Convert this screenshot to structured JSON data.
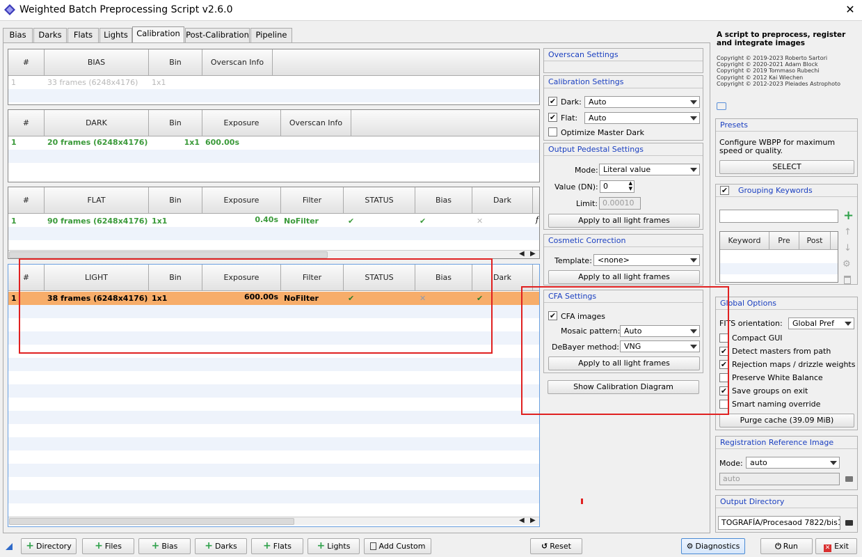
{
  "window": {
    "title": "Weighted Batch Preprocessing Script v2.6.0"
  },
  "tabs": [
    "Bias",
    "Darks",
    "Flats",
    "Lights",
    "Calibration",
    "Post-Calibration",
    "Pipeline"
  ],
  "bias_table": {
    "headers": [
      "#",
      "BIAS",
      "Bin",
      "Overscan Info"
    ],
    "row": [
      "1",
      "33 frames (6248x4176)",
      "1x1",
      ""
    ]
  },
  "dark_table": {
    "headers": [
      "#",
      "DARK",
      "Bin",
      "Exposure",
      "Overscan Info"
    ],
    "row": [
      "1",
      "20 frames (6248x4176)",
      "1x1",
      "600.00s",
      ""
    ]
  },
  "flat_table": {
    "headers": [
      "#",
      "FLAT",
      "Bin",
      "Exposure",
      "Filter",
      "STATUS",
      "Bias",
      "Dark"
    ],
    "row": [
      "1",
      "90 frames (6248x4176)",
      "1x1",
      "0.40s",
      "NoFilter",
      "✔",
      "✔",
      "✕"
    ],
    "extra": "f"
  },
  "light_table": {
    "headers": [
      "#",
      "LIGHT",
      "Bin",
      "Exposure",
      "Filter",
      "STATUS",
      "Bias",
      "Dark"
    ],
    "row": [
      "1",
      "38 frames (6248x4176)",
      "1x1",
      "600.00s",
      "NoFilter",
      "✔",
      "✕",
      "✔"
    ]
  },
  "overscan": {
    "title": "Overscan Settings"
  },
  "calibration": {
    "title": "Calibration Settings",
    "dark_label": "Dark:",
    "dark_value": "Auto",
    "flat_label": "Flat:",
    "flat_value": "Auto",
    "optimize_label": "Optimize Master Dark"
  },
  "pedestal": {
    "title": "Output Pedestal Settings",
    "mode_label": "Mode:",
    "mode_value": "Literal value",
    "value_label": "Value (DN):",
    "value": "0",
    "limit_label": "Limit:",
    "limit_value": "0.00010",
    "apply_label": "Apply to all light frames"
  },
  "cosmetic": {
    "title": "Cosmetic Correction",
    "template_label": "Template:",
    "template_value": "<none>",
    "apply_label": "Apply to all light frames"
  },
  "cfa": {
    "title": "CFA Settings",
    "cfa_label": "CFA images",
    "mosaic_label": "Mosaic pattern:",
    "mosaic_value": "Auto",
    "debayer_label": "DeBayer method:",
    "debayer_value": "VNG",
    "apply_label": "Apply to all light frames"
  },
  "show_diagram_label": "Show Calibration Diagram",
  "info": {
    "heading": "A script to preprocess, register and integrate images",
    "copyright": [
      "Copyright © 2019-2023 Roberto Sartori",
      "Copyright © 2020-2021 Adam Block",
      "Copyright © 2019 Tommaso Rubechi",
      "Copyright © 2012 Kai Wiechen",
      "Copyright © 2012-2023 Pleiades Astrophoto"
    ]
  },
  "presets": {
    "title": "Presets",
    "text": "Configure WBPP for maximum speed or quality.",
    "select_label": "SELECT"
  },
  "grouping": {
    "title": "Grouping Keywords",
    "headers": [
      "Keyword",
      "Pre",
      "Post"
    ]
  },
  "global": {
    "title": "Global Options",
    "fits_label": "FITS orientation:",
    "fits_value": "Global Pref",
    "options": [
      {
        "label": "Compact GUI",
        "checked": false
      },
      {
        "label": "Detect masters from path",
        "checked": true
      },
      {
        "label": "Rejection maps / drizzle weights",
        "checked": true
      },
      {
        "label": "Preserve White Balance",
        "checked": false
      },
      {
        "label": "Save groups on exit",
        "checked": true
      },
      {
        "label": "Smart naming override",
        "checked": false
      }
    ],
    "purge_label": "Purge cache (39.09 MiB)"
  },
  "registration": {
    "title": "Registration Reference Image",
    "mode_label": "Mode:",
    "mode_value": "auto",
    "field_value": "auto"
  },
  "output": {
    "title": "Output Directory",
    "path": "TOGRAFÍA/Procesaod 7822/bis1"
  },
  "bottom": {
    "directory": "Directory",
    "files": "Files",
    "bias": "Bias",
    "darks": "Darks",
    "flats": "Flats",
    "lights": "Lights",
    "add_custom": "Add Custom",
    "reset": "Reset",
    "diagnostics": "Diagnostics",
    "run": "Run",
    "exit": "Exit"
  }
}
